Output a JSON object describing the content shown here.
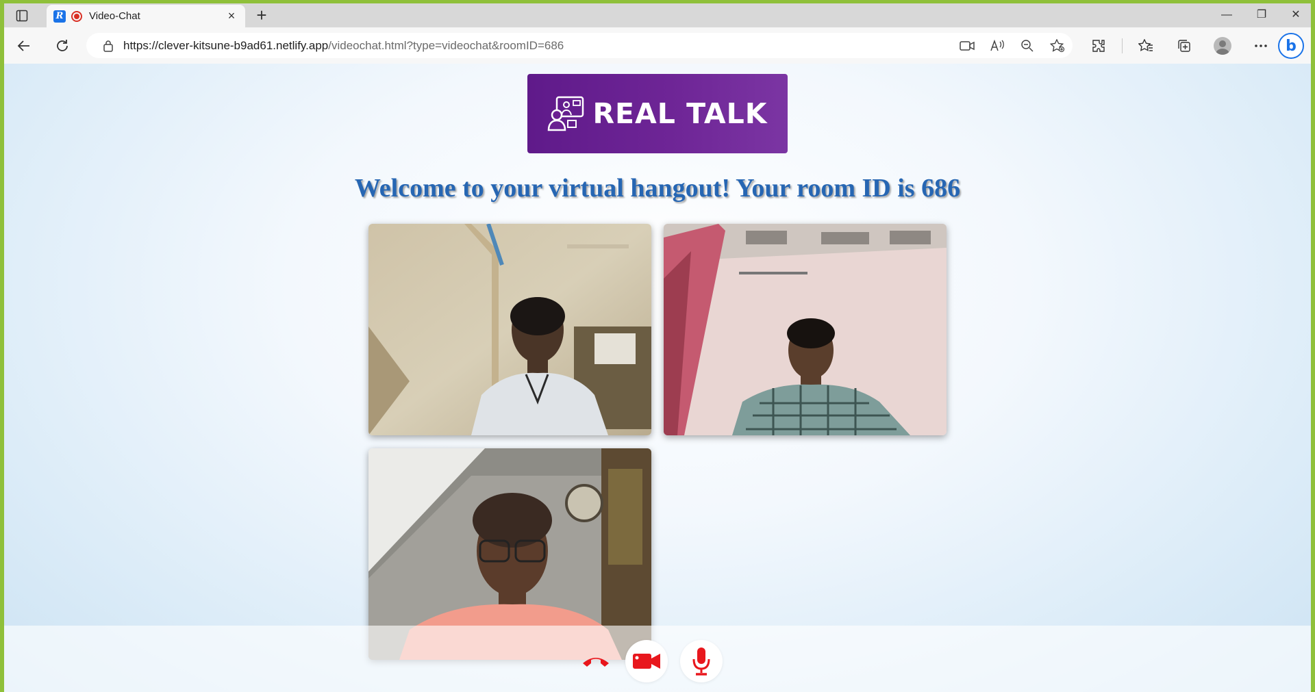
{
  "browser": {
    "tab_title": "Video-Chat",
    "tab_close": "×",
    "new_tab": "+",
    "url_host": "https://clever-kitsune-b9ad61.netlify.app",
    "url_path": "/videochat.html?type=videochat&roomID=686",
    "window_controls": {
      "minimize": "—",
      "restore": "❐",
      "close": "✕"
    },
    "icons": [
      "sidebar-icon",
      "back-icon",
      "refresh-icon",
      "lock-icon",
      "camera-icon",
      "read-aloud-icon",
      "zoom-out-icon",
      "favorite-add-icon",
      "extensions-icon",
      "favorites-icon",
      "collections-icon",
      "profile-icon",
      "more-icon",
      "bing-icon"
    ]
  },
  "page": {
    "logo_text": "REAL TALK",
    "welcome": "Welcome to your virtual hangout! Your room ID is 686"
  },
  "participants": [
    {
      "slot": 1,
      "label": "participant-video-1"
    },
    {
      "slot": 2,
      "label": "participant-video-2"
    },
    {
      "slot": 3,
      "label": "participant-video-3"
    }
  ],
  "controls": {
    "items": [
      "hangup-icon",
      "camera-toggle-icon",
      "microphone-icon"
    ],
    "accent": "#e8171d"
  },
  "colors": {
    "logo_bg": "#6a1f92",
    "welcome_text": "#2666b3",
    "window_border": "#8fc03a"
  }
}
